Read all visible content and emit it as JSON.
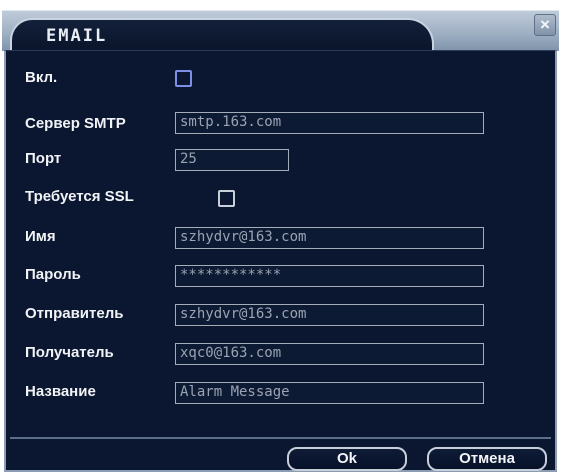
{
  "window": {
    "title": "EMAIL",
    "close_label": "×"
  },
  "form": {
    "enable_label": "Вкл.",
    "smtp_label": "Сервер SMTP",
    "smtp_value": "smtp.163.com",
    "port_label": "Порт",
    "port_value": "25",
    "ssl_label": "Требуется SSL",
    "name_label": "Имя",
    "name_value": "szhydvr@163.com",
    "password_label": "Пароль",
    "password_value": "************",
    "sender_label": "Отправитель",
    "sender_value": "szhydvr@163.com",
    "recipient_label": "Получатель",
    "recipient_value": "xqc0@163.com",
    "subject_label": "Название",
    "subject_value": "Alarm Message"
  },
  "buttons": {
    "ok_label": "Ok",
    "cancel_label": "Отмена"
  },
  "colors": {
    "panel_bg": "#0b1730",
    "titlebar": "#9fb0c4",
    "checkbox_accent": "#7e8fe8"
  }
}
